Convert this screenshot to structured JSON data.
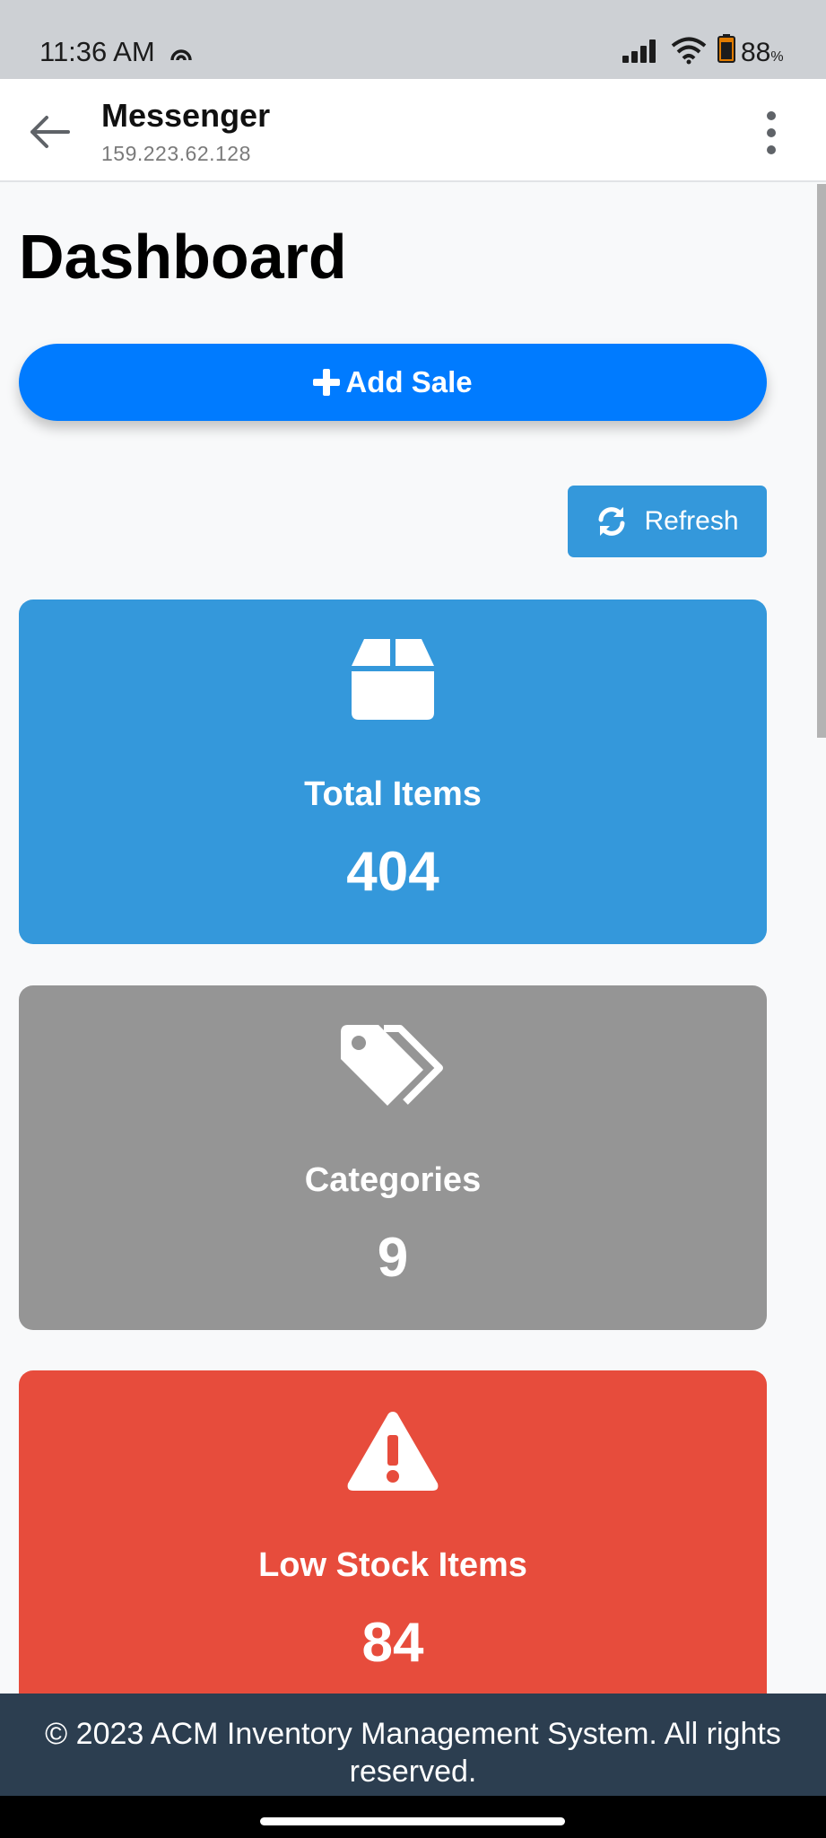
{
  "status_bar": {
    "time": "11:36 AM",
    "battery": "88",
    "battery_unit": "%"
  },
  "app_bar": {
    "title": "Messenger",
    "subtitle": "159.223.62.128"
  },
  "page": {
    "title": "Dashboard",
    "add_sale_label": "Add Sale",
    "refresh_label": "Refresh"
  },
  "cards": [
    {
      "label": "Total Items",
      "value": "404",
      "color": "#3498db",
      "icon": "box-icon"
    },
    {
      "label": "Categories",
      "value": "9",
      "color": "#959595",
      "icon": "tags-icon"
    },
    {
      "label": "Low Stock Items",
      "value": "84",
      "color": "#e74c3c",
      "icon": "warning-icon"
    }
  ],
  "footer": {
    "text": "© 2023 ACM Inventory Management System. All rights reserved."
  },
  "colors": {
    "primary": "#007bff",
    "refresh": "#3498db",
    "footer_bg": "#2c3e50"
  }
}
